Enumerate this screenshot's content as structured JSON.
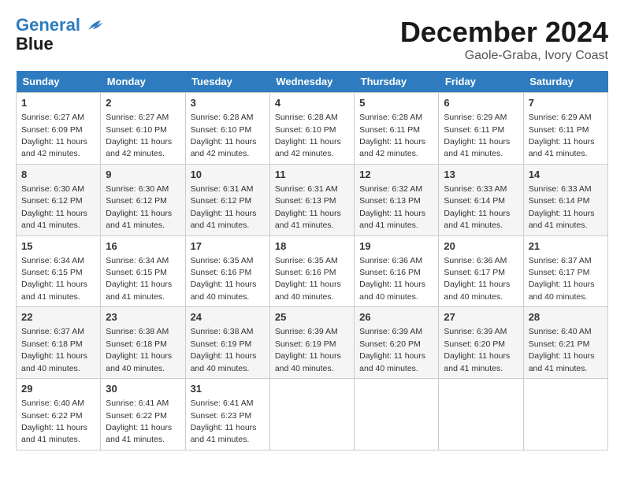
{
  "header": {
    "logo_line1": "General",
    "logo_line2": "Blue",
    "month_year": "December 2024",
    "location": "Gaole-Graba, Ivory Coast"
  },
  "days_of_week": [
    "Sunday",
    "Monday",
    "Tuesday",
    "Wednesday",
    "Thursday",
    "Friday",
    "Saturday"
  ],
  "weeks": [
    [
      {
        "day": "1",
        "sunrise": "6:27 AM",
        "sunset": "6:09 PM",
        "daylight": "11 hours and 42 minutes."
      },
      {
        "day": "2",
        "sunrise": "6:27 AM",
        "sunset": "6:10 PM",
        "daylight": "11 hours and 42 minutes."
      },
      {
        "day": "3",
        "sunrise": "6:28 AM",
        "sunset": "6:10 PM",
        "daylight": "11 hours and 42 minutes."
      },
      {
        "day": "4",
        "sunrise": "6:28 AM",
        "sunset": "6:10 PM",
        "daylight": "11 hours and 42 minutes."
      },
      {
        "day": "5",
        "sunrise": "6:28 AM",
        "sunset": "6:11 PM",
        "daylight": "11 hours and 42 minutes."
      },
      {
        "day": "6",
        "sunrise": "6:29 AM",
        "sunset": "6:11 PM",
        "daylight": "11 hours and 41 minutes."
      },
      {
        "day": "7",
        "sunrise": "6:29 AM",
        "sunset": "6:11 PM",
        "daylight": "11 hours and 41 minutes."
      }
    ],
    [
      {
        "day": "8",
        "sunrise": "6:30 AM",
        "sunset": "6:12 PM",
        "daylight": "11 hours and 41 minutes."
      },
      {
        "day": "9",
        "sunrise": "6:30 AM",
        "sunset": "6:12 PM",
        "daylight": "11 hours and 41 minutes."
      },
      {
        "day": "10",
        "sunrise": "6:31 AM",
        "sunset": "6:12 PM",
        "daylight": "11 hours and 41 minutes."
      },
      {
        "day": "11",
        "sunrise": "6:31 AM",
        "sunset": "6:13 PM",
        "daylight": "11 hours and 41 minutes."
      },
      {
        "day": "12",
        "sunrise": "6:32 AM",
        "sunset": "6:13 PM",
        "daylight": "11 hours and 41 minutes."
      },
      {
        "day": "13",
        "sunrise": "6:33 AM",
        "sunset": "6:14 PM",
        "daylight": "11 hours and 41 minutes."
      },
      {
        "day": "14",
        "sunrise": "6:33 AM",
        "sunset": "6:14 PM",
        "daylight": "11 hours and 41 minutes."
      }
    ],
    [
      {
        "day": "15",
        "sunrise": "6:34 AM",
        "sunset": "6:15 PM",
        "daylight": "11 hours and 41 minutes."
      },
      {
        "day": "16",
        "sunrise": "6:34 AM",
        "sunset": "6:15 PM",
        "daylight": "11 hours and 41 minutes."
      },
      {
        "day": "17",
        "sunrise": "6:35 AM",
        "sunset": "6:16 PM",
        "daylight": "11 hours and 40 minutes."
      },
      {
        "day": "18",
        "sunrise": "6:35 AM",
        "sunset": "6:16 PM",
        "daylight": "11 hours and 40 minutes."
      },
      {
        "day": "19",
        "sunrise": "6:36 AM",
        "sunset": "6:16 PM",
        "daylight": "11 hours and 40 minutes."
      },
      {
        "day": "20",
        "sunrise": "6:36 AM",
        "sunset": "6:17 PM",
        "daylight": "11 hours and 40 minutes."
      },
      {
        "day": "21",
        "sunrise": "6:37 AM",
        "sunset": "6:17 PM",
        "daylight": "11 hours and 40 minutes."
      }
    ],
    [
      {
        "day": "22",
        "sunrise": "6:37 AM",
        "sunset": "6:18 PM",
        "daylight": "11 hours and 40 minutes."
      },
      {
        "day": "23",
        "sunrise": "6:38 AM",
        "sunset": "6:18 PM",
        "daylight": "11 hours and 40 minutes."
      },
      {
        "day": "24",
        "sunrise": "6:38 AM",
        "sunset": "6:19 PM",
        "daylight": "11 hours and 40 minutes."
      },
      {
        "day": "25",
        "sunrise": "6:39 AM",
        "sunset": "6:19 PM",
        "daylight": "11 hours and 40 minutes."
      },
      {
        "day": "26",
        "sunrise": "6:39 AM",
        "sunset": "6:20 PM",
        "daylight": "11 hours and 40 minutes."
      },
      {
        "day": "27",
        "sunrise": "6:39 AM",
        "sunset": "6:20 PM",
        "daylight": "11 hours and 41 minutes."
      },
      {
        "day": "28",
        "sunrise": "6:40 AM",
        "sunset": "6:21 PM",
        "daylight": "11 hours and 41 minutes."
      }
    ],
    [
      {
        "day": "29",
        "sunrise": "6:40 AM",
        "sunset": "6:22 PM",
        "daylight": "11 hours and 41 minutes."
      },
      {
        "day": "30",
        "sunrise": "6:41 AM",
        "sunset": "6:22 PM",
        "daylight": "11 hours and 41 minutes."
      },
      {
        "day": "31",
        "sunrise": "6:41 AM",
        "sunset": "6:23 PM",
        "daylight": "11 hours and 41 minutes."
      },
      null,
      null,
      null,
      null
    ]
  ]
}
